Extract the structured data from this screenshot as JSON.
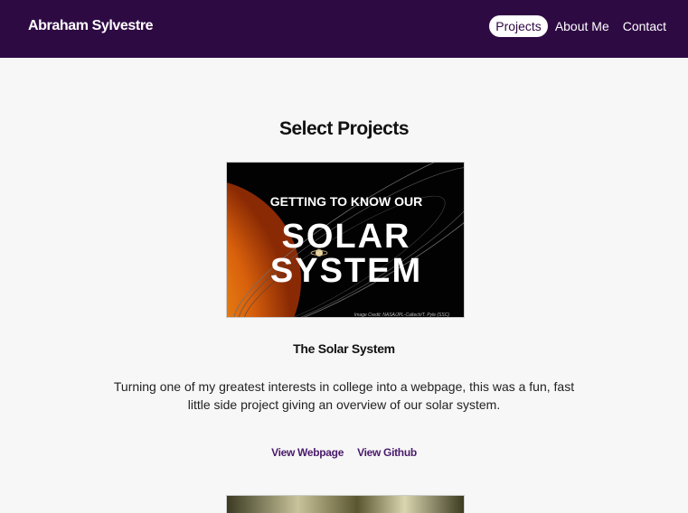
{
  "header": {
    "brand": "Abraham Sylvestre",
    "nav": [
      {
        "label": "Projects",
        "active": true
      },
      {
        "label": "About Me",
        "active": false
      },
      {
        "label": "Contact",
        "active": false
      }
    ]
  },
  "main": {
    "section_title": "Select Projects",
    "projects": [
      {
        "image": {
          "line1": "GETTING TO KNOW OUR",
          "line2": "SOLAR",
          "line3": "SYSTEM",
          "credit": "Image Credit: NASA/JPL-Caltech/T. Pyle (SSC)"
        },
        "title": "The Solar System",
        "description": "Turning one of my greatest interests in college into a webpage, this was a fun, fast little side project giving an overview of our solar system.",
        "links": [
          "View Webpage",
          "View Github"
        ]
      }
    ]
  },
  "colors": {
    "navbar": "#2e0a43",
    "background": "#f7f7f7",
    "link": "#4a1a6b"
  }
}
